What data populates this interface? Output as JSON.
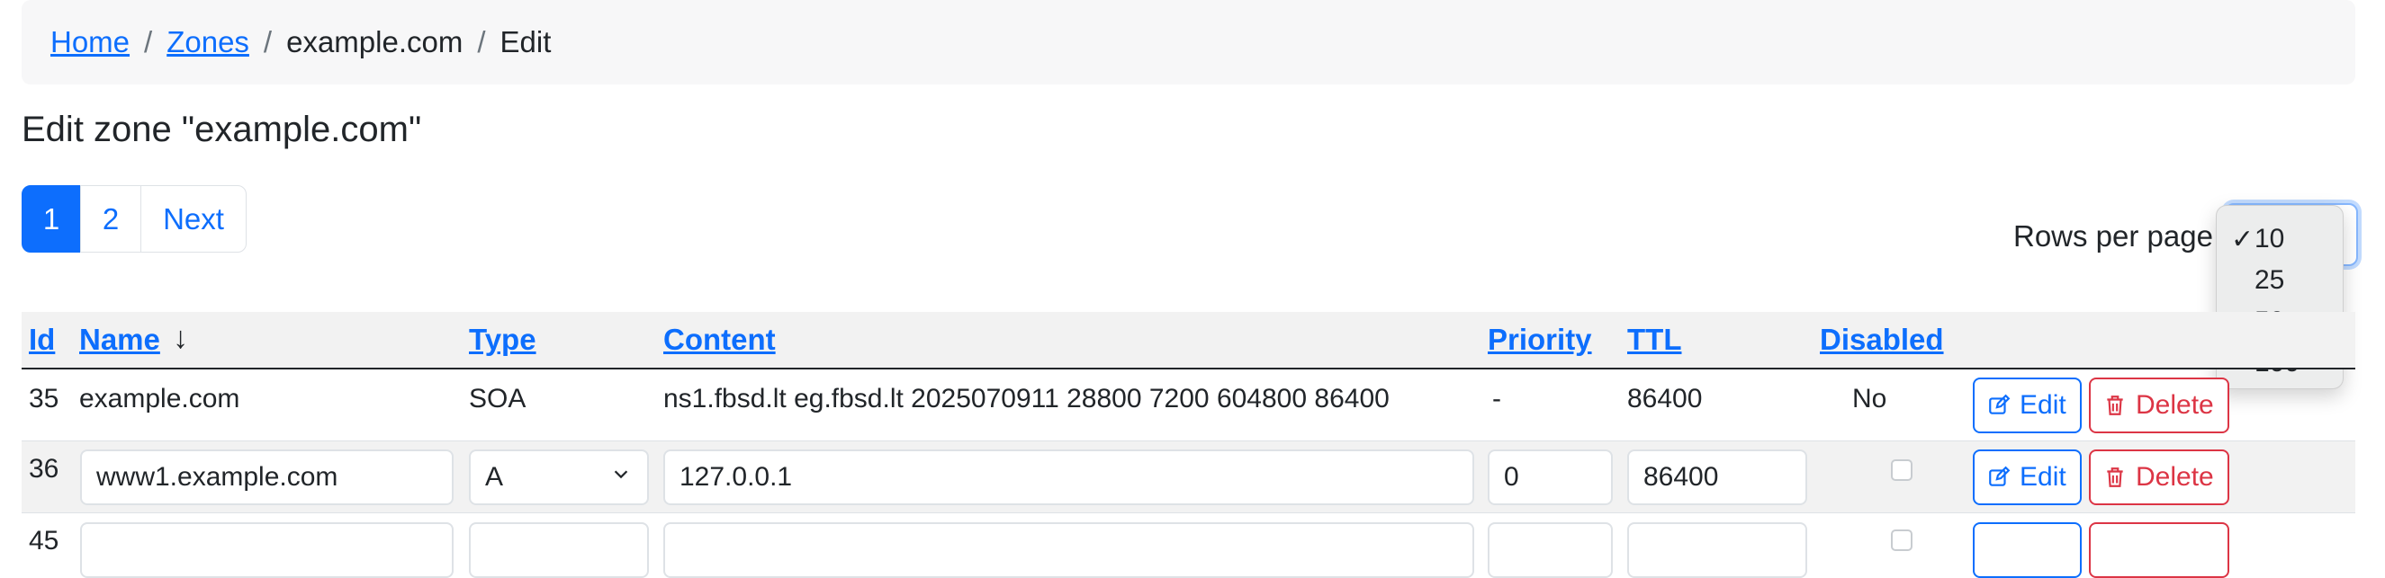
{
  "breadcrumb": {
    "home": "Home",
    "zones": "Zones",
    "zone": "example.com",
    "current": "Edit",
    "separator": "/"
  },
  "page_title": "Edit zone \"example.com\"",
  "pagination": {
    "pages": [
      "1",
      "2"
    ],
    "active": "1",
    "next": "Next"
  },
  "rows_per_page": {
    "label": "Rows per page:",
    "options": [
      "10",
      "25",
      "50",
      "100"
    ],
    "selected": "10",
    "check": "✓"
  },
  "table": {
    "headers": {
      "id": "Id",
      "name": "Name",
      "name_sort_arrow": "↓",
      "type": "Type",
      "content": "Content",
      "priority": "Priority",
      "ttl": "TTL",
      "disabled": "Disabled"
    },
    "rows": [
      {
        "id": "35",
        "name": "example.com",
        "type": "SOA",
        "content": "ns1.fbsd.lt eg.fbsd.lt 2025070911 28800 7200 604800 86400",
        "priority": "-",
        "ttl": "86400",
        "disabled": "No"
      },
      {
        "id": "36",
        "name": "www1.example.com",
        "type": "A",
        "content": "127.0.0.1",
        "priority": "0",
        "ttl": "86400",
        "disabled": false
      }
    ],
    "partial_row_id": "45",
    "edit_label": "Edit",
    "delete_label": "Delete"
  },
  "colors": {
    "primary": "#0d6efd",
    "danger": "#dc3545",
    "breadcrumb_bg": "#f7f7f8",
    "header_bg": "#f2f2f2"
  }
}
